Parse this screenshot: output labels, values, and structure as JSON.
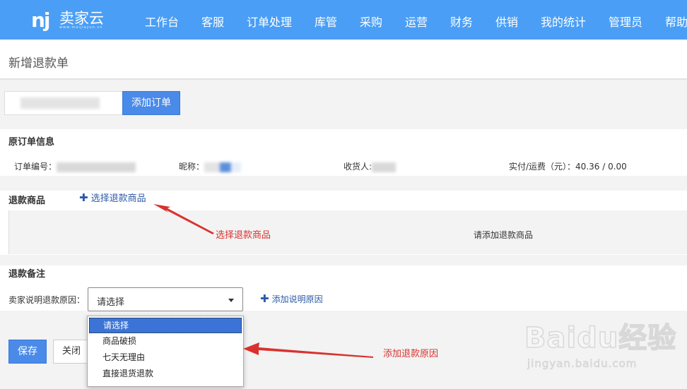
{
  "header": {
    "logo_text": "卖家云",
    "logo_url": "www.maijiayun.cn",
    "nav": [
      "工作台",
      "客服",
      "订单处理",
      "库管",
      "采购",
      "运营",
      "财务",
      "供销",
      "我的统计",
      "管理员",
      "帮助"
    ]
  },
  "page_title": "新增退款单",
  "add_order_button": "添加订单",
  "order_info": {
    "title": "原订单信息",
    "order_no_label": "订单编号：",
    "nickname_label": "昵称：",
    "receiver_label": "收货人:",
    "payment_label": "实付/运费（元）：40.36 / 0.00"
  },
  "refund_goods": {
    "title": "退款商品",
    "select_link": "选择退款商品",
    "empty_text": "请添加退款商品"
  },
  "refund_note": {
    "title": "退款备注",
    "reason_label": "卖家说明退款原因：",
    "select_value": "请选择",
    "add_reason_link": "添加说明原因",
    "options": [
      "请选择",
      "商品破损",
      "七天无理由",
      "直接退货退款"
    ]
  },
  "annotations": {
    "select_goods": "选择退款商品",
    "add_reason": "添加退款原因"
  },
  "buttons": {
    "save": "保存",
    "close": "关闭"
  },
  "watermark": {
    "brand": "Baidu经验",
    "url": "jingyan.baidu.com"
  },
  "colors": {
    "header": "#4a9ef5",
    "primary_button": "#4a8ae8",
    "link": "#2d5aa8",
    "annotation": "#d9322e"
  }
}
